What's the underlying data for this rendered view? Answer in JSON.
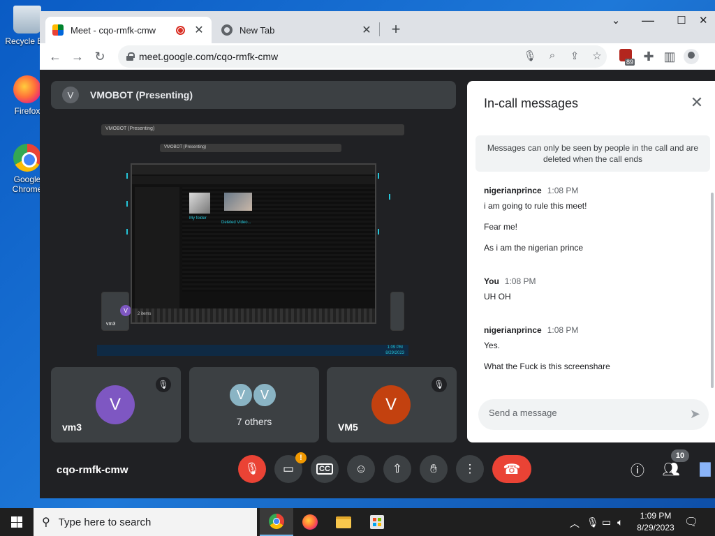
{
  "desktop": {
    "icons": [
      {
        "label": "Recycle Bin"
      },
      {
        "label": "Firefox"
      },
      {
        "label": "Google Chrome"
      }
    ]
  },
  "browser": {
    "tabs": [
      {
        "title": "Meet - cqo-rmfk-cmw",
        "close": "✕"
      },
      {
        "title": "New Tab",
        "close": "✕"
      }
    ],
    "new_tab": "+",
    "window_controls": {
      "minimize": "⌄",
      "maximize": "☐",
      "close": "✕"
    },
    "url": "meet.google.com/cqo-rmfk-cmw",
    "extension_badge": "89"
  },
  "meet": {
    "presenter": {
      "initial": "V",
      "label": "VMOBOT (Presenting)"
    },
    "shared_screen": {
      "nested_title_1": "VMOBOT (Presenting)",
      "nested_title_2": "VMOBOT (Presenting)",
      "folder1": "My folder",
      "folder2_caption": "Deleted Video...",
      "status": "2 items",
      "mini_time": "1:09 PM",
      "mini_date": "8/29/2023",
      "mini_tile": "vm3"
    },
    "tiles": [
      {
        "initial": "V",
        "name": "vm3",
        "color": "#7e57c2"
      },
      {
        "initials": [
          "V",
          "V"
        ],
        "label": "7 others"
      },
      {
        "initial": "V",
        "name": "VM5",
        "color": "#c3410f"
      }
    ],
    "chat": {
      "title": "In-call messages",
      "notice": "Messages can only be seen by people in the call and are deleted when the call ends",
      "groups": [
        {
          "sender": "nigerianprince",
          "time": "1:08 PM",
          "messages": [
            "i am going to rule this meet!",
            "Fear me!",
            "As i am the nigerian prince"
          ]
        },
        {
          "sender": "You",
          "time": "1:08 PM",
          "messages": [
            "UH OH"
          ]
        },
        {
          "sender": "nigerianprince",
          "time": "1:08 PM",
          "messages": [
            "Yes.",
            "What the Fuck is this screenshare"
          ]
        }
      ],
      "input_placeholder": "Send a message"
    },
    "meeting_code": "cqo-rmfk-cmw",
    "camera_badge": "!",
    "people_count": "10"
  },
  "taskbar": {
    "search_placeholder": "Type here to search",
    "time": "1:09 PM",
    "date": "8/29/2023"
  }
}
